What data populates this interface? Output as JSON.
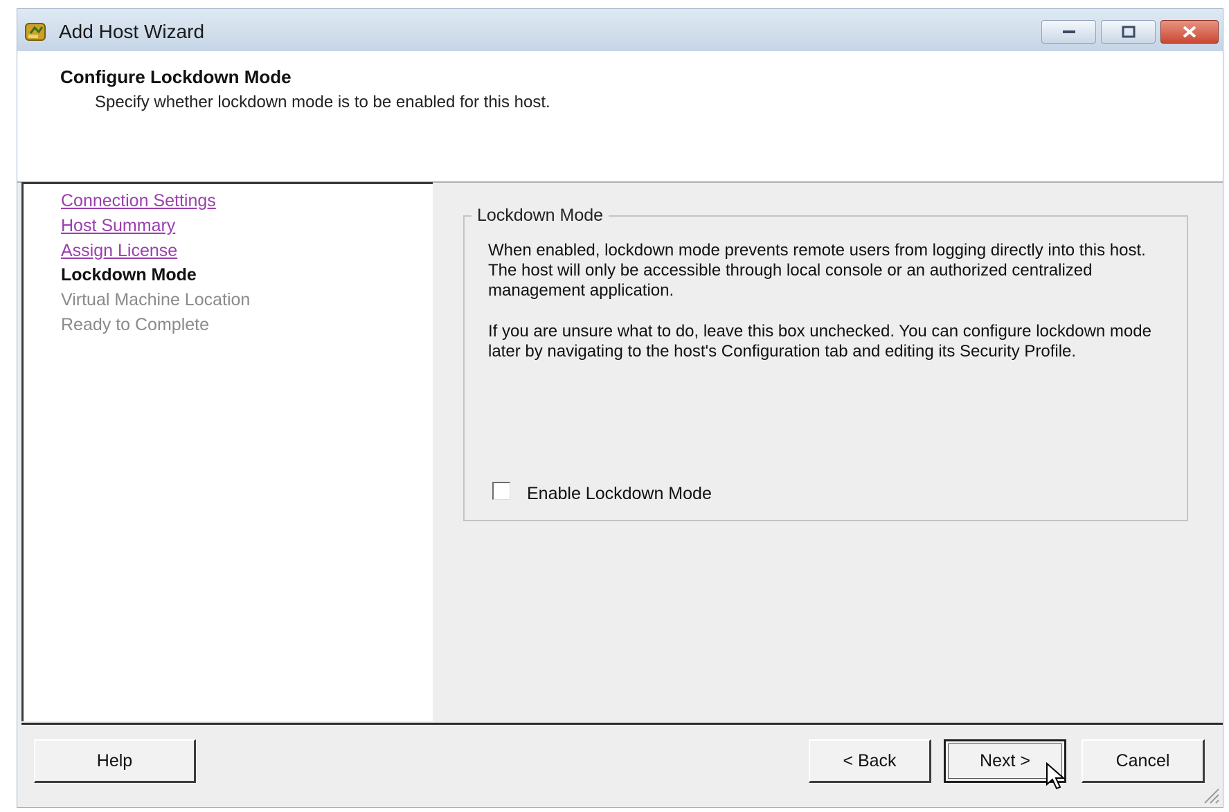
{
  "window": {
    "title": "Add Host Wizard",
    "icon": "vsphere-host-icon"
  },
  "header": {
    "step_title": "Configure Lockdown Mode",
    "step_subtitle": "Specify whether lockdown mode is to be enabled for this host."
  },
  "nav": {
    "items": [
      {
        "label": "Connection Settings",
        "state": "visited-link"
      },
      {
        "label": "Host Summary",
        "state": "visited-link"
      },
      {
        "label": "Assign License",
        "state": "visited-link"
      },
      {
        "label": "Lockdown Mode",
        "state": "current"
      },
      {
        "label": "Virtual Machine Location",
        "state": "future"
      },
      {
        "label": "Ready to Complete",
        "state": "future"
      }
    ]
  },
  "content": {
    "group_label": "Lockdown Mode",
    "paragraph1": "When enabled, lockdown mode prevents remote users from logging directly into this host. The host will only be accessible through local console or an authorized centralized management application.",
    "paragraph2": "If you are unsure what to do, leave this box unchecked. You can configure lockdown mode later by navigating to the host's Configuration tab and editing its Security Profile.",
    "checkbox_label": "Enable Lockdown Mode",
    "checkbox_checked": false
  },
  "footer": {
    "help_label": "Help",
    "back_label": "< Back",
    "next_label": "Next >",
    "cancel_label": "Cancel"
  },
  "colors": {
    "link_visited": "#9b3fae",
    "future_step": "#8a8a8a",
    "dialog_bg": "#eeeeef",
    "close_button": "#c94833"
  }
}
